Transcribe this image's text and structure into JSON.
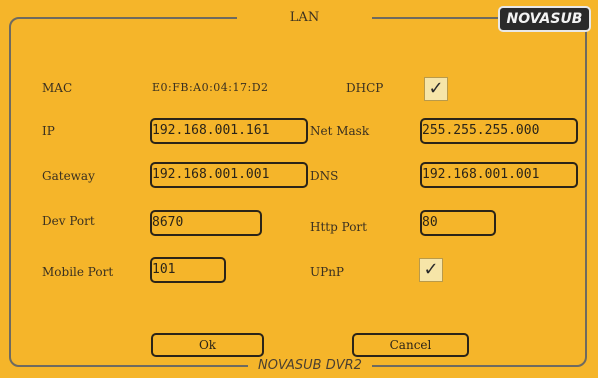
{
  "window": {
    "title": "LAN",
    "brand": "NOVASUB",
    "footer": "NOVASUB DVR2"
  },
  "mac": {
    "label": "MAC",
    "value": "E0:FB:A0:04:17:D2"
  },
  "dhcp": {
    "label": "DHCP",
    "checked": true,
    "mark": "✓"
  },
  "ip": {
    "label": "IP",
    "value": "192.168.001.161"
  },
  "netmask": {
    "label": "Net Mask",
    "value": "255.255.255.000"
  },
  "gateway": {
    "label": "Gateway",
    "value": "192.168.001.001"
  },
  "dns": {
    "label": "DNS",
    "value": "192.168.001.001"
  },
  "dev_port": {
    "label": "Dev Port",
    "value": "8670"
  },
  "http_port": {
    "label": "Http Port",
    "value": "80"
  },
  "mobile_port": {
    "label": "Mobile Port",
    "value": "101"
  },
  "upnp": {
    "label": "UPnP",
    "checked": true,
    "mark": "✓"
  },
  "buttons": {
    "ok": "Ok",
    "cancel": "Cancel"
  },
  "colors": {
    "background": "#F5B52A",
    "border": "#2B2418"
  }
}
